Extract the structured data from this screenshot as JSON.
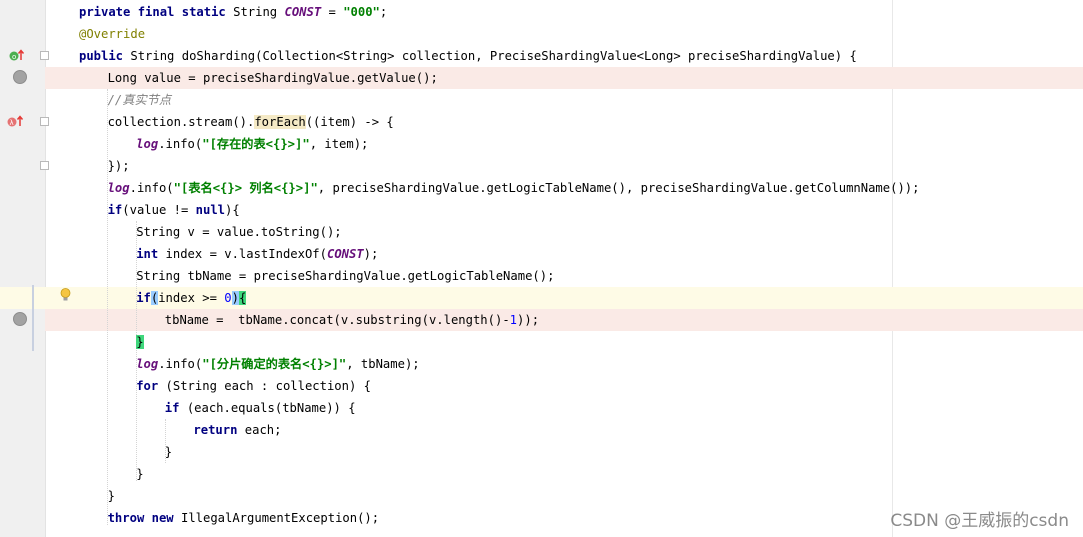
{
  "code_lines": [
    {
      "indent": 0,
      "tokens": [
        [
          "kw",
          "private "
        ],
        [
          "kw",
          "final "
        ],
        [
          "kw",
          "static "
        ],
        [
          "",
          "String "
        ],
        [
          "cst",
          "CONST"
        ],
        [
          "",
          " = "
        ],
        [
          "str",
          "\"000\""
        ],
        [
          "",
          ";"
        ]
      ]
    },
    {
      "indent": 0,
      "tokens": [
        [
          "anno",
          "@Override"
        ]
      ]
    },
    {
      "indent": 0,
      "tokens": [
        [
          "kw",
          "public "
        ],
        [
          "",
          "String doSharding(Collection<String> collection, PreciseShardingValue<Long> preciseShardingValue) {"
        ]
      ]
    },
    {
      "indent": 1,
      "tokens": [
        [
          "",
          "Long value = preciseShardingValue.getValue();"
        ]
      ]
    },
    {
      "indent": 1,
      "tokens": [
        [
          "cmt",
          "//真实节点"
        ]
      ]
    },
    {
      "indent": 1,
      "tokens": [
        [
          "",
          "collection.stream()."
        ],
        [
          "meth-hl",
          "forEach"
        ],
        [
          "",
          "((item) -> {"
        ]
      ]
    },
    {
      "indent": 2,
      "tokens": [
        [
          "log",
          "log"
        ],
        [
          "",
          ".info("
        ],
        [
          "str",
          "\"[存在的表<{}>]\""
        ],
        [
          "",
          ", item);"
        ]
      ]
    },
    {
      "indent": 1,
      "tokens": [
        [
          "",
          "});"
        ]
      ]
    },
    {
      "indent": 1,
      "tokens": [
        [
          "log",
          "log"
        ],
        [
          "",
          ".info("
        ],
        [
          "str",
          "\"[表名<{}> 列名<{}>]\""
        ],
        [
          "",
          ", preciseShardingValue.getLogicTableName(), preciseShardingValue.getColumnName());"
        ]
      ]
    },
    {
      "indent": 1,
      "tokens": [
        [
          "kw",
          "if"
        ],
        [
          "",
          "(value != "
        ],
        [
          "kw",
          "null"
        ],
        [
          "",
          "){"
        ]
      ]
    },
    {
      "indent": 2,
      "tokens": [
        [
          "",
          "String v = value.toString();"
        ]
      ]
    },
    {
      "indent": 2,
      "tokens": [
        [
          "kw",
          "int "
        ],
        [
          "",
          "index = v.lastIndexOf("
        ],
        [
          "cst",
          "CONST"
        ],
        [
          "",
          ");"
        ]
      ]
    },
    {
      "indent": 2,
      "tokens": [
        [
          "",
          "String tbName = preciseShardingValue.getLogicTableName();"
        ]
      ]
    },
    {
      "indent": 2,
      "tokens": [
        [
          "kw",
          "if"
        ],
        [
          "paren-hl",
          "("
        ],
        [
          "",
          "index >= "
        ],
        [
          "num",
          "0"
        ],
        [
          "paren-hl",
          ")"
        ],
        [
          "brace-hl",
          "{"
        ]
      ]
    },
    {
      "indent": 3,
      "tokens": [
        [
          "",
          "tbName =  tbName.concat(v.substring(v.length()-"
        ],
        [
          "num",
          "1"
        ],
        [
          "",
          "));"
        ]
      ]
    },
    {
      "indent": 2,
      "tokens": [
        [
          "brace-hl",
          "}"
        ]
      ]
    },
    {
      "indent": 2,
      "tokens": [
        [
          "log",
          "log"
        ],
        [
          "",
          ".info("
        ],
        [
          "str",
          "\"[分片确定的表名<{}>]\""
        ],
        [
          "",
          ", tbName);"
        ]
      ]
    },
    {
      "indent": 2,
      "tokens": [
        [
          "kw",
          "for "
        ],
        [
          "",
          "(String each : collection) {"
        ]
      ]
    },
    {
      "indent": 3,
      "tokens": [
        [
          "kw",
          "if "
        ],
        [
          "",
          "(each.equals(tbName)) {"
        ]
      ]
    },
    {
      "indent": 4,
      "tokens": [
        [
          "kw",
          "return "
        ],
        [
          "",
          "each;"
        ]
      ]
    },
    {
      "indent": 3,
      "tokens": [
        [
          "",
          "}"
        ]
      ]
    },
    {
      "indent": 2,
      "tokens": [
        [
          "",
          "}"
        ]
      ]
    },
    {
      "indent": 1,
      "tokens": [
        [
          "",
          "}"
        ]
      ]
    },
    {
      "indent": 1,
      "tokens": [
        [
          "kw",
          "throw "
        ],
        [
          "kw",
          "new "
        ],
        [
          "",
          "IllegalArgumentException();"
        ]
      ]
    }
  ],
  "gutter": {
    "override_icon": "override-method-icon",
    "lambda_icon": "lambda-icon",
    "breakpoint_icon": "breakpoint-icon",
    "fold_icon": "fold-marker-icon",
    "bulb_icon": "intention-bulb-icon"
  },
  "watermark": "CSDN @王威振的csdn"
}
